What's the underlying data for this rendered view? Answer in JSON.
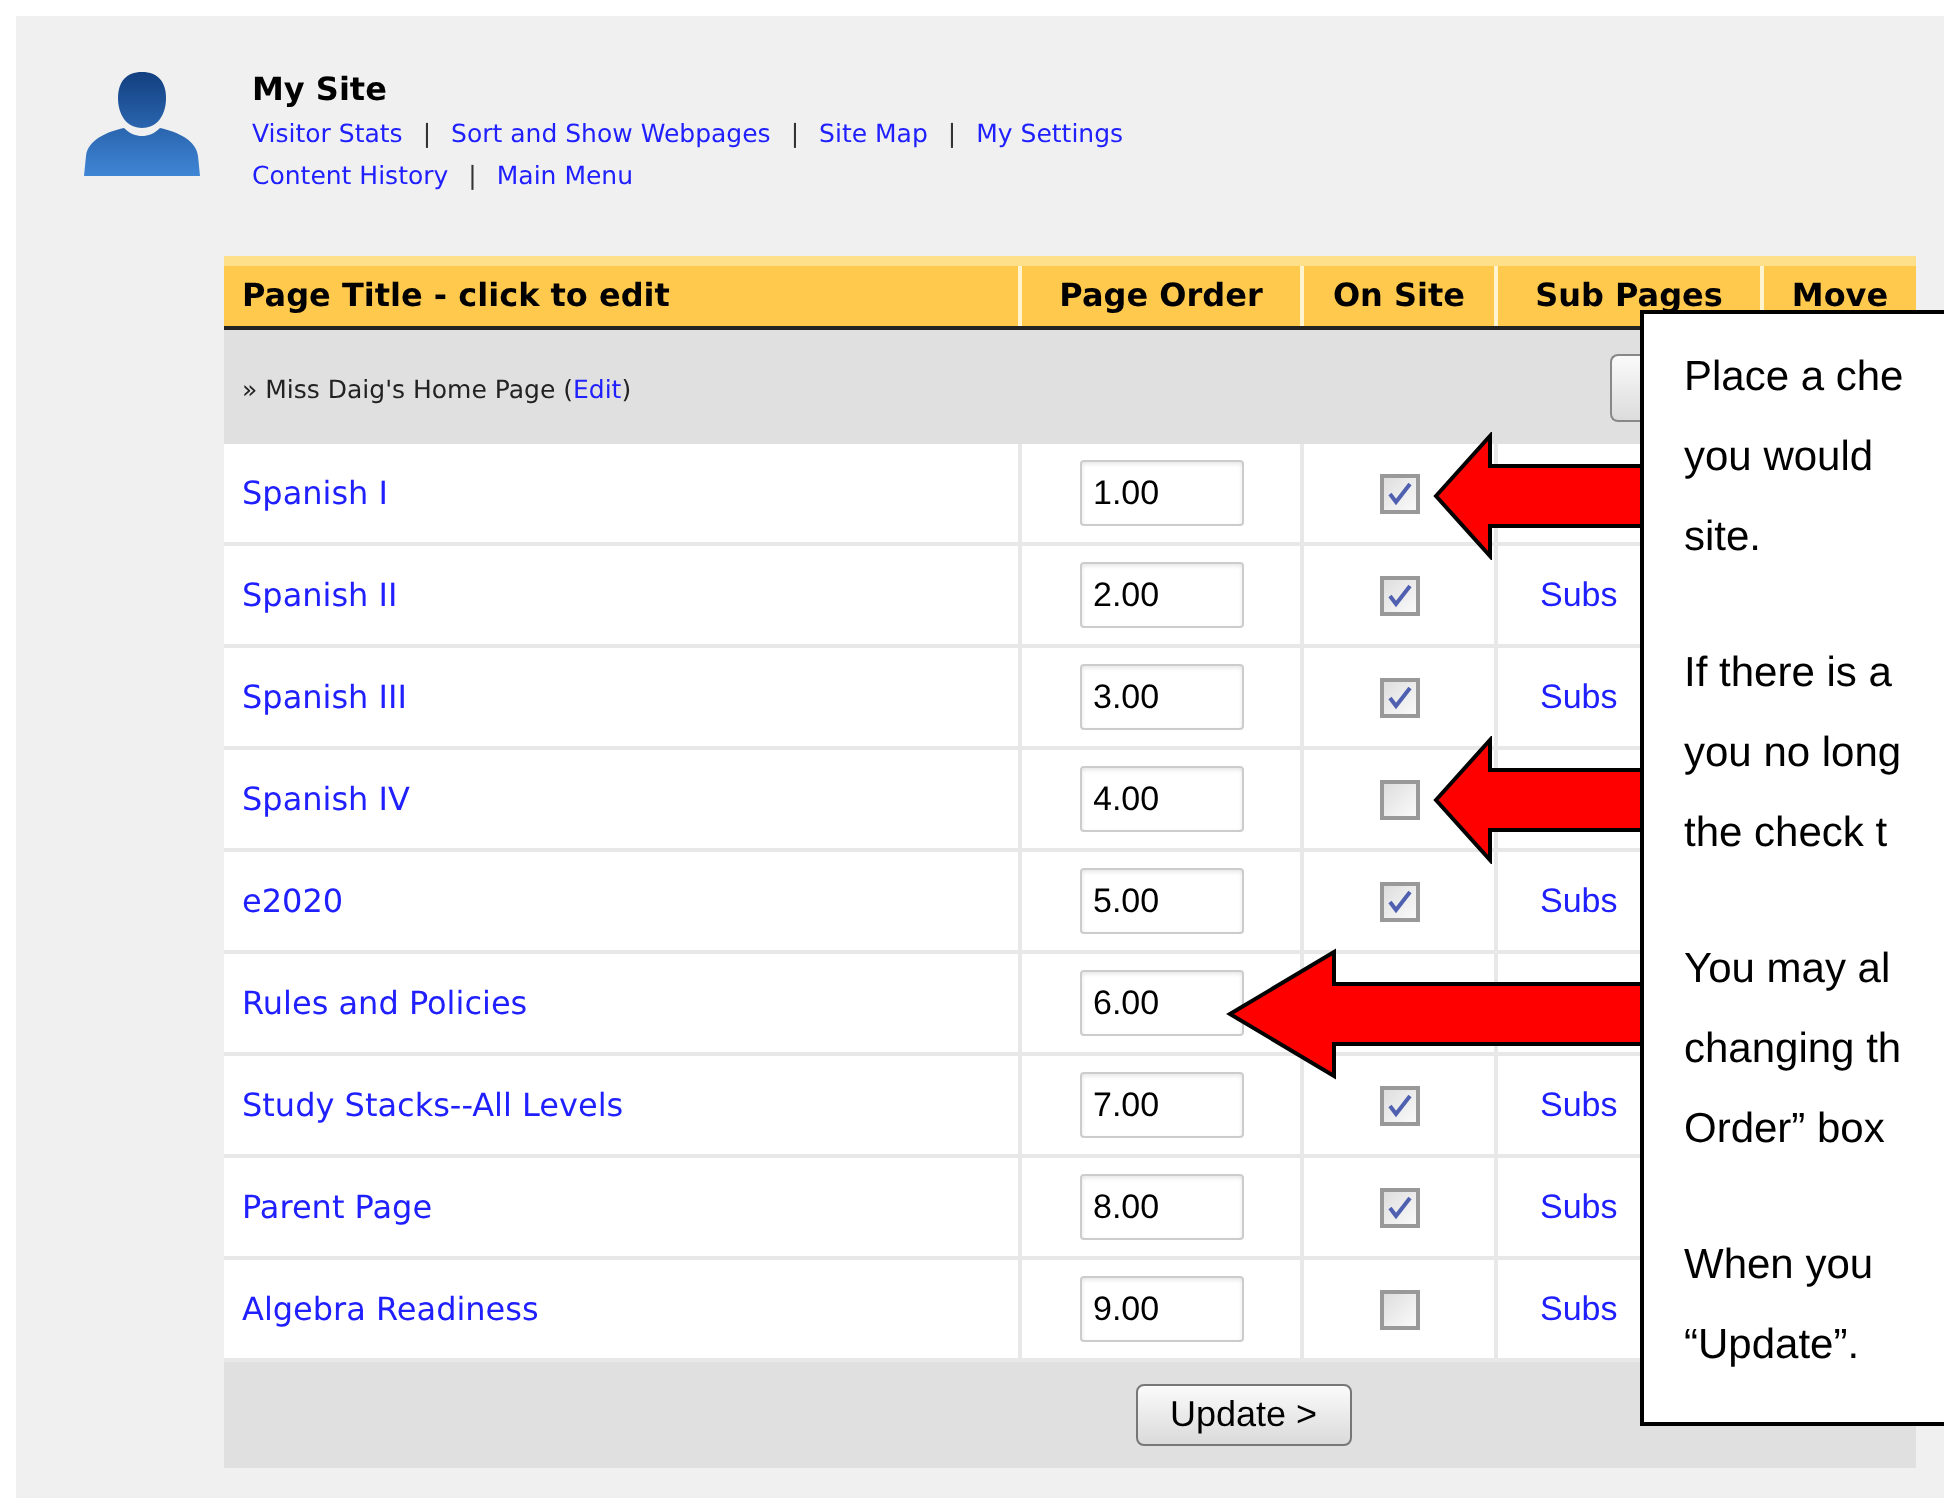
{
  "header": {
    "title": "My Site",
    "nav_lines": [
      [
        "Visitor Stats",
        "Sort and Show Webpages",
        "Site Map",
        "My Settings"
      ],
      [
        "Content History",
        "Main Menu"
      ]
    ],
    "separator": "|"
  },
  "table": {
    "columns": [
      "Page Title - click to edit",
      "Page Order",
      "On Site",
      "Sub Pages",
      "Move"
    ],
    "home_row": {
      "prefix": "» Miss Daig's Home Page (",
      "link": "Edit",
      "suffix": ")"
    },
    "rows": [
      {
        "title": "Spanish I",
        "order": "1.00",
        "checkbox": {
          "checked": true
        }
      },
      {
        "title": "Spanish II",
        "order": "2.00",
        "checkbox": {
          "checked": true
        },
        "subs": "Subs"
      },
      {
        "title": "Spanish III",
        "order": "3.00",
        "checkbox": {
          "checked": true
        },
        "subs": "Subs"
      },
      {
        "title": "Spanish IV",
        "order": "4.00",
        "checkbox": {
          "checked": false
        }
      },
      {
        "title": "e2020",
        "order": "5.00",
        "checkbox": {
          "checked": true
        },
        "subs": "Subs"
      },
      {
        "title": "Rules and Policies",
        "order": "6.00"
      },
      {
        "title": "Study Stacks--All Levels",
        "order": "7.00",
        "checkbox": {
          "checked": true
        },
        "subs": "Subs"
      },
      {
        "title": "Parent Page",
        "order": "8.00",
        "checkbox": {
          "checked": true
        },
        "subs": "Subs"
      },
      {
        "title": "Algebra Readiness",
        "order": "9.00",
        "checkbox": {
          "checked": false
        },
        "subs": "Subs"
      }
    ],
    "update_button": "Update >"
  },
  "callout": {
    "paragraphs": [
      [
        "Place a che",
        "you would",
        "site."
      ],
      [
        "If there is a",
        "you no long",
        "the check t"
      ],
      [
        "You may al",
        "changing th",
        "Order” box"
      ],
      [
        "When you",
        "“Update”."
      ]
    ]
  }
}
